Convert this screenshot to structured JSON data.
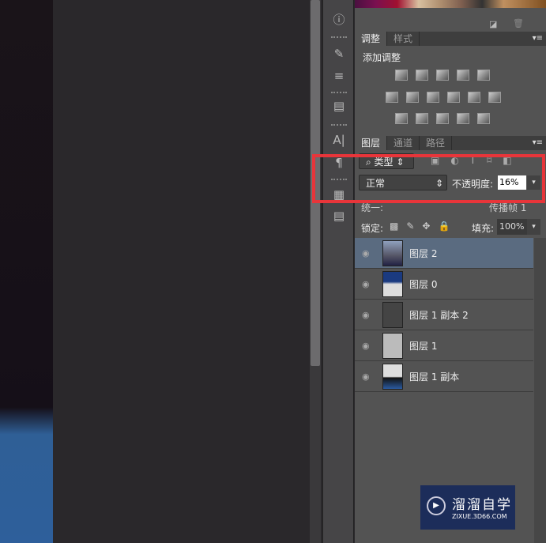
{
  "adjust_panel": {
    "tabs": [
      "调整",
      "样式"
    ],
    "title": "添加调整"
  },
  "layers_panel": {
    "tabs": [
      "图层",
      "通道",
      "路径"
    ],
    "filter": "类型",
    "blend_mode": "正常",
    "opacity_label": "不透明度:",
    "opacity_value": "16%",
    "unify_label": "统一:",
    "propagate_label": "传播帧 1",
    "lock_label": "锁定:",
    "fill_label": "填充:",
    "fill_value": "100%",
    "layers": [
      {
        "name": "图层 2",
        "selected": true
      },
      {
        "name": "图层 0"
      },
      {
        "name": "图层 1 副本 2"
      },
      {
        "name": "图层 1"
      },
      {
        "name": "图层 1 副本"
      }
    ]
  },
  "watermark": {
    "title": "溜溜自学",
    "url": "ZIXUE.3D66.COM"
  },
  "colors": {
    "highlight": "#e8353a",
    "selected_row": "#5a6b80"
  }
}
